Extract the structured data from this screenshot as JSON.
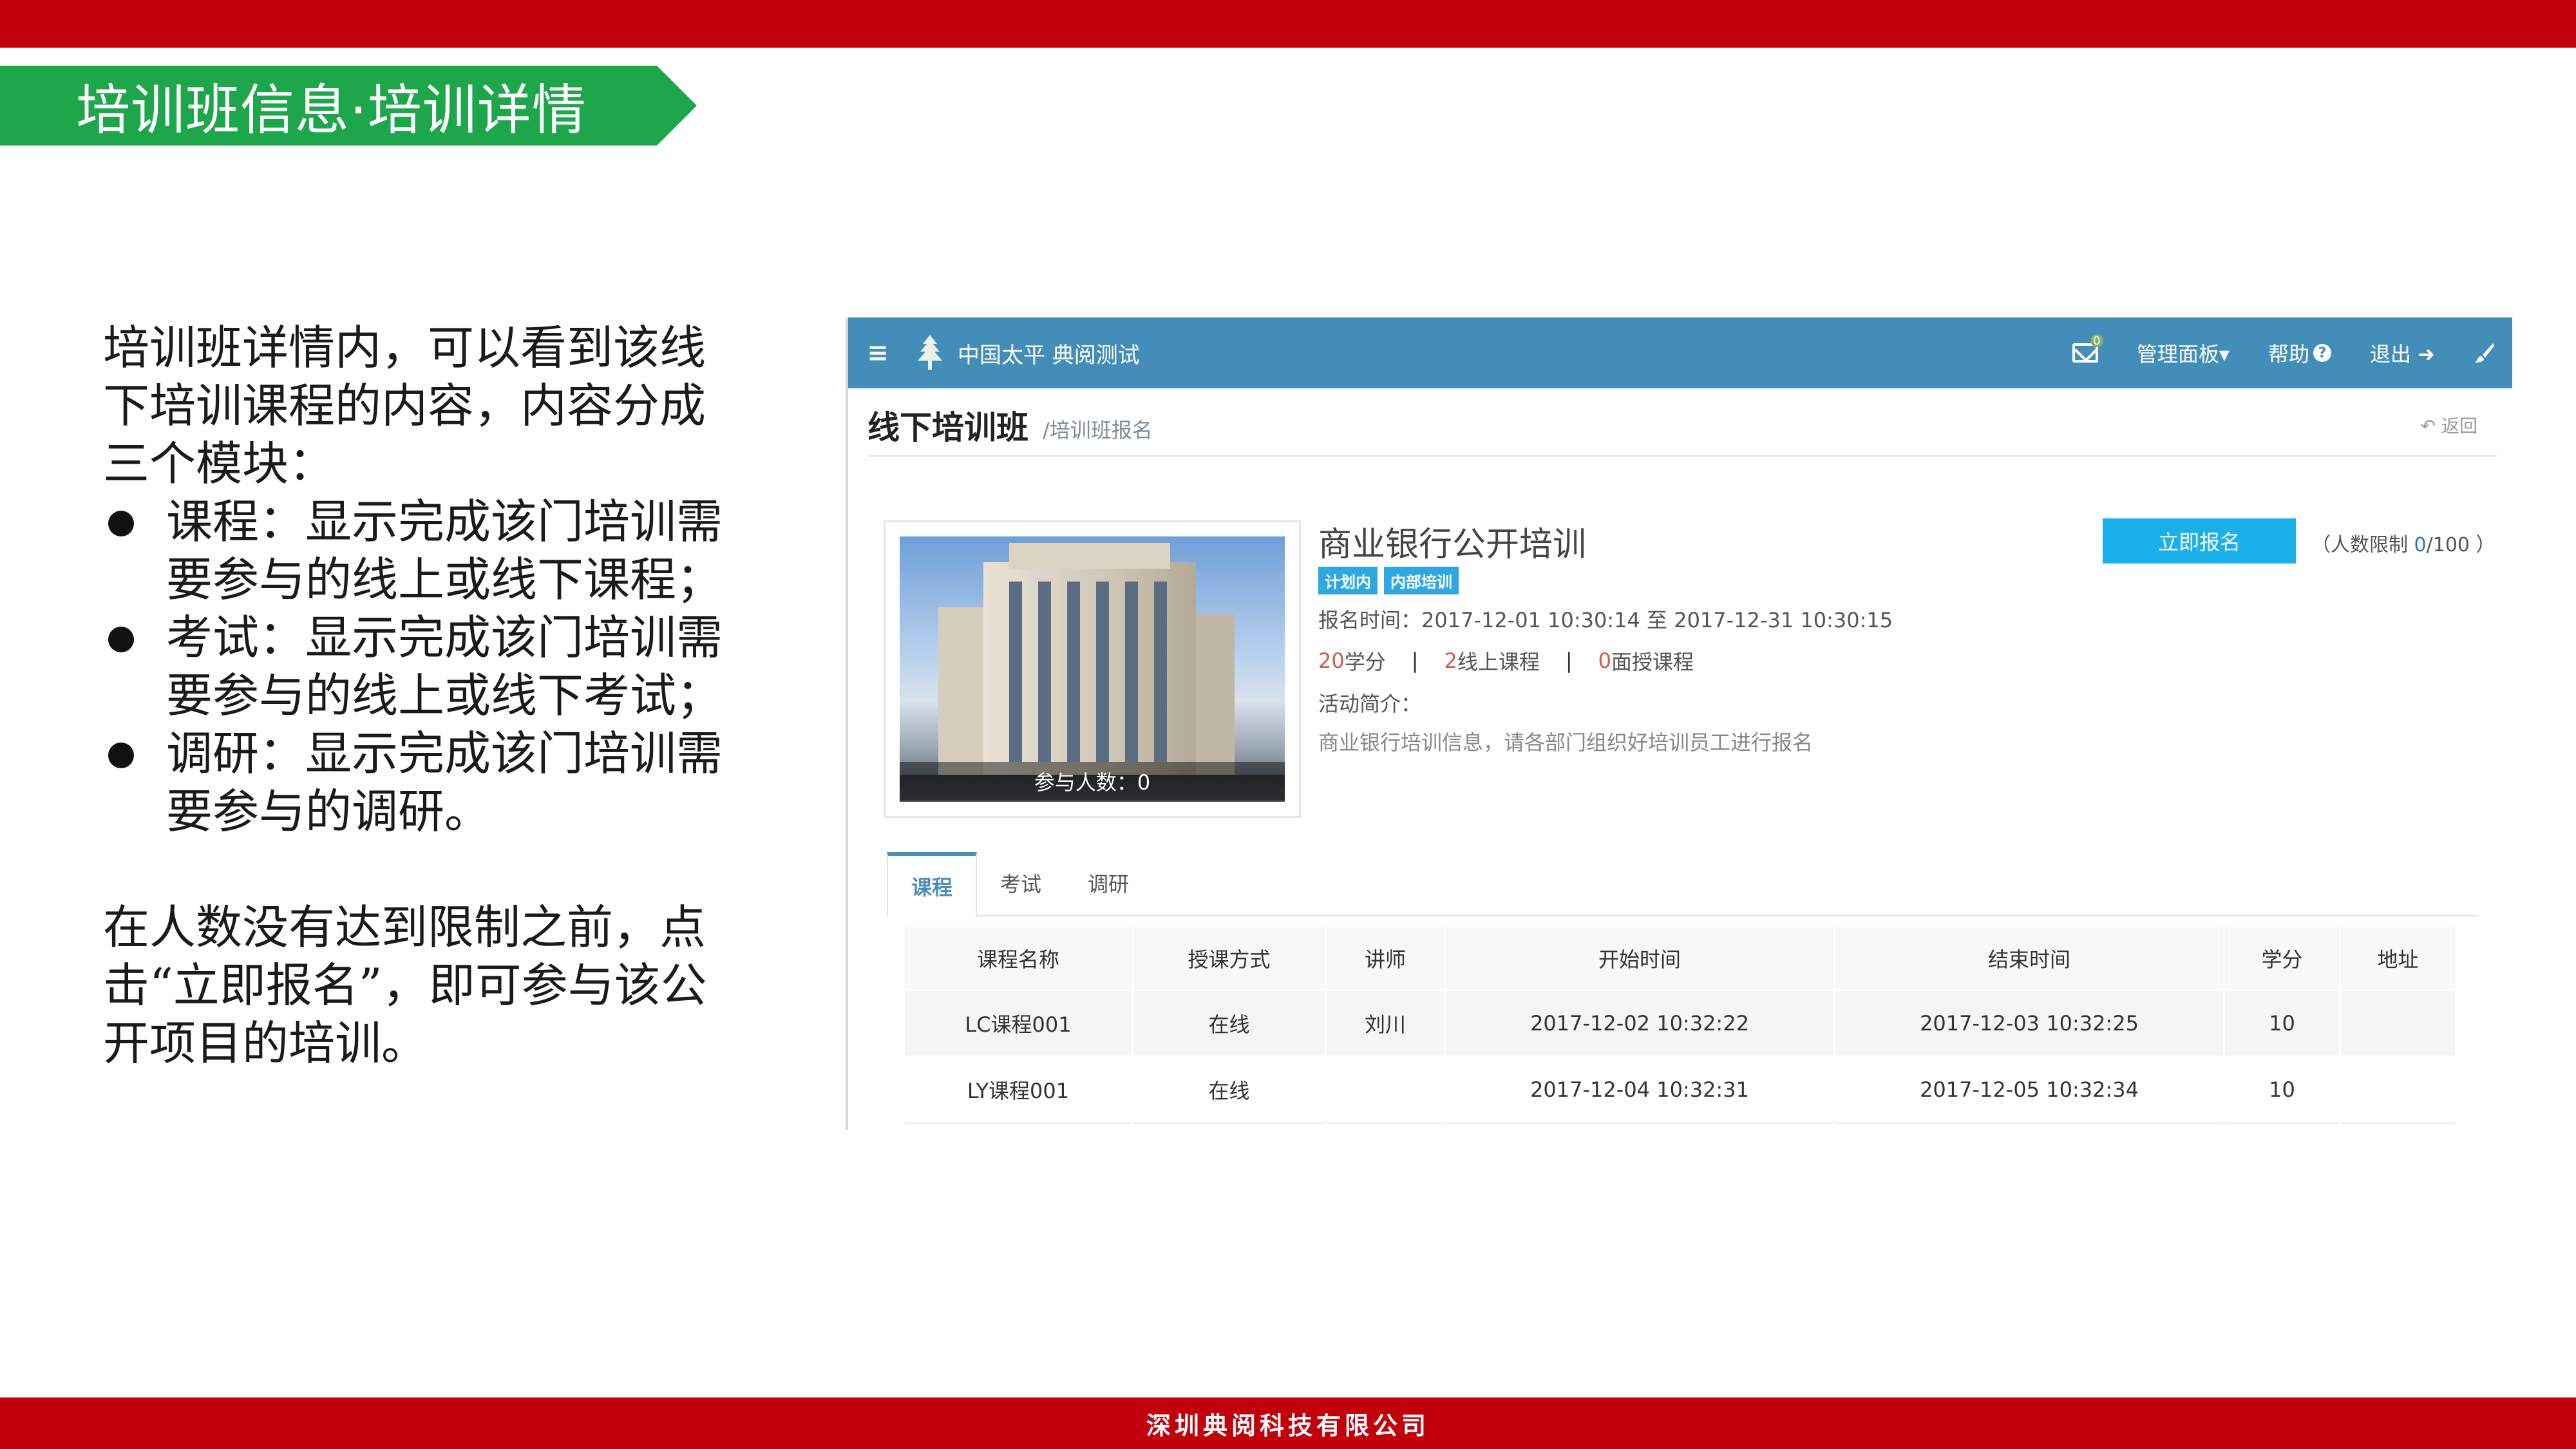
{
  "slide": {
    "title": "培训班信息·培训详情",
    "footer": "深圳典阅科技有限公司",
    "description": {
      "intro": "培训班详情内，可以看到该线下培训课程的内容，内容分成三个模块：",
      "bullets": [
        "课程：显示完成该门培训需要参与的线上或线下课程；",
        "考试：显示完成该门培训需要参与的线上或线下考试；",
        "调研：显示完成该门培训需要参与的调研。"
      ],
      "outro": "在人数没有达到限制之前，点击“立即报名”，即可参与该公开项目的培训。"
    }
  },
  "app": {
    "brand": "中国太平 典阅测试",
    "nav": {
      "mail_badge": "0",
      "manage": "管理面板▾",
      "help": "帮助",
      "logout": "退出 ➜"
    },
    "page": {
      "title": "线下培训班",
      "subtitle": "/培训班报名",
      "back": "返回"
    },
    "course": {
      "name": "商业银行公开培训",
      "tags": [
        "计划内",
        "内部培训"
      ],
      "register_time": "报名时间：2017-12-01 10:30:14 至 2017-12-31 10:30:15",
      "credits_num": "20",
      "credits_label": "学分",
      "online_num": "2",
      "online_label": "线上课程",
      "offline_num": "0",
      "offline_label": "面授课程",
      "intro_label": "活动简介：",
      "intro_text": "商业银行培训信息，请各部门组织好培训员工进行报名",
      "participants": "参与人数：0",
      "signup_button": "立即报名",
      "limit_prefix": "（人数限制 ",
      "limit_current": "0",
      "limit_suffix": "/100 ）"
    },
    "tabs": [
      "课程",
      "考试",
      "调研"
    ],
    "table": {
      "headers": [
        "课程名称",
        "授课方式",
        "讲师",
        "开始时间",
        "结束时间",
        "学分",
        "地址"
      ],
      "rows": [
        [
          "LC课程001",
          "在线",
          "刘川",
          "2017-12-02 10:32:22",
          "2017-12-03 10:32:25",
          "10",
          ""
        ],
        [
          "LY课程001",
          "在线",
          "",
          "2017-12-04 10:32:31",
          "2017-12-05 10:32:34",
          "10",
          ""
        ]
      ]
    }
  },
  "colors": {
    "slide_red": "#c1000b",
    "ribbon_green": "#1ea64a",
    "navbar_blue": "#438eb9",
    "button_blue": "#1ab0ea",
    "tag_blue": "#2fa7e0",
    "number_red": "#d15b47"
  },
  "icons": [
    "menu-icon",
    "tree-logo-icon",
    "mail-icon",
    "question-icon",
    "logout-icon",
    "brush-icon",
    "reply-icon"
  ]
}
